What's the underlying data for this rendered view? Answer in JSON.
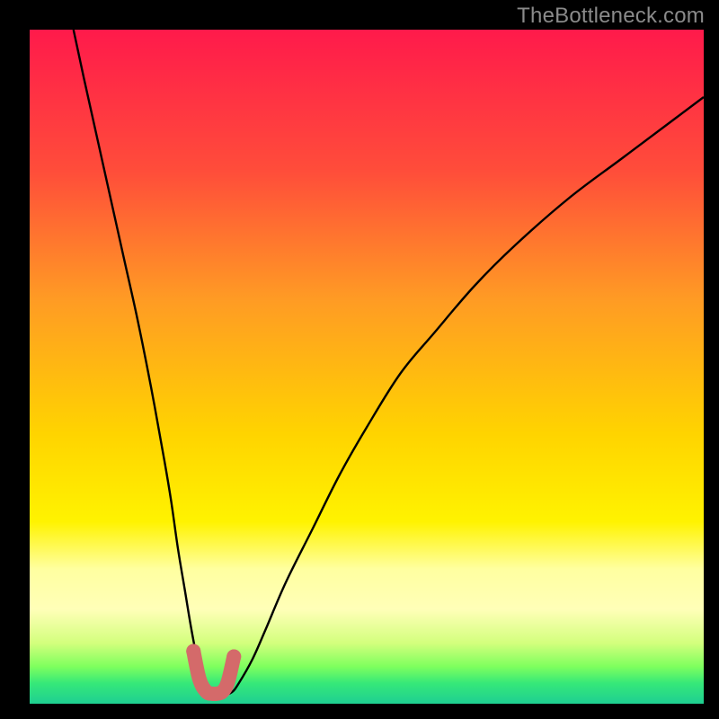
{
  "watermark": "TheBottleneck.com",
  "chart_data": {
    "type": "line",
    "title": "",
    "xlabel": "",
    "ylabel": "",
    "xlim": [
      0,
      100
    ],
    "ylim": [
      0,
      100
    ],
    "grid": false,
    "legend": false,
    "gradient_stops": [
      {
        "offset": 0,
        "color": "#ff1a4b"
      },
      {
        "offset": 0.21,
        "color": "#ff4d3a"
      },
      {
        "offset": 0.4,
        "color": "#ff9b24"
      },
      {
        "offset": 0.6,
        "color": "#ffd400"
      },
      {
        "offset": 0.73,
        "color": "#fff300"
      },
      {
        "offset": 0.8,
        "color": "#ffffa0"
      },
      {
        "offset": 0.86,
        "color": "#ffffb8"
      },
      {
        "offset": 0.91,
        "color": "#d3ff7d"
      },
      {
        "offset": 0.945,
        "color": "#7eff5e"
      },
      {
        "offset": 0.97,
        "color": "#35e879"
      },
      {
        "offset": 1.0,
        "color": "#1fcf92"
      }
    ],
    "series": [
      {
        "name": "main-curve",
        "color": "#000000",
        "x": [
          6.5,
          8,
          10,
          12,
          14,
          16,
          18,
          20,
          21,
          22,
          23,
          24,
          25,
          26,
          27,
          28,
          29,
          30,
          31,
          33,
          35,
          38,
          42,
          46,
          50,
          55,
          60,
          66,
          72,
          80,
          88,
          96,
          100
        ],
        "y": [
          100,
          93,
          84,
          75,
          66,
          57,
          47,
          36,
          30,
          23,
          17,
          11,
          6,
          3,
          1.7,
          1.4,
          1.4,
          1.7,
          3,
          6.5,
          11,
          18,
          26,
          34,
          41,
          49,
          55,
          62,
          68,
          75,
          81,
          87,
          90
        ]
      },
      {
        "name": "highlight-segment",
        "color": "#d46a6a",
        "stroke_width": 16,
        "linecap": "round",
        "x": [
          24.3,
          25.2,
          26.2,
          27.0,
          27.8,
          28.6,
          29.4,
          30.3
        ],
        "y": [
          7.8,
          3.6,
          1.8,
          1.5,
          1.5,
          1.8,
          3.2,
          7.0
        ]
      }
    ]
  }
}
